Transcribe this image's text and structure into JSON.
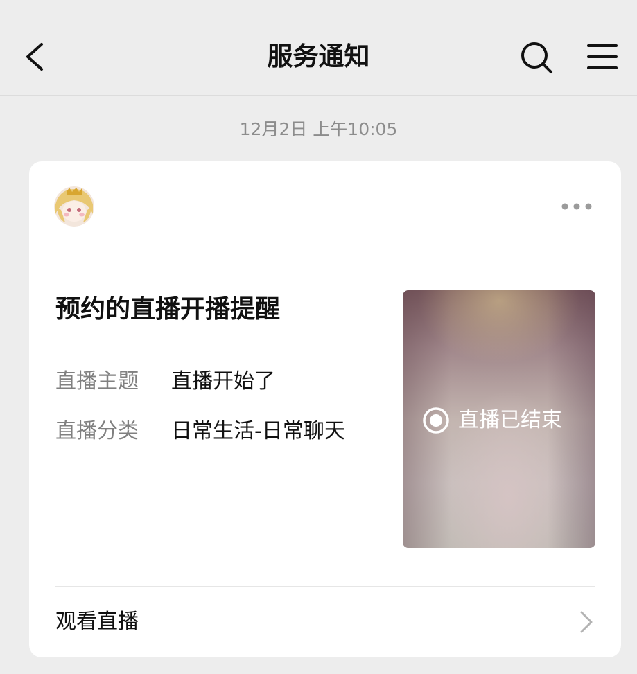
{
  "nav": {
    "title": "服务通知",
    "back_icon": "back-arrow-icon",
    "search_icon": "search-icon",
    "menu_icon": "menu-icon"
  },
  "timestamp": "12月2日 上午10:05",
  "card": {
    "more_icon": "more-dots-icon",
    "title": "预约的直播开播提醒",
    "fields": [
      {
        "label": "直播主题",
        "value": "直播开始了"
      },
      {
        "label": "直播分类",
        "value": "日常生活-日常聊天"
      }
    ],
    "thumbnail": {
      "status_icon": "live-record-icon",
      "status_text": "直播已结束"
    },
    "action": {
      "label": "观看直播",
      "icon": "chevron-right-icon"
    }
  },
  "colors": {
    "background": "#ededed",
    "card": "#ffffff",
    "primary_text": "#111111",
    "secondary_text": "#808080",
    "timestamp_text": "#8c8c8c"
  }
}
